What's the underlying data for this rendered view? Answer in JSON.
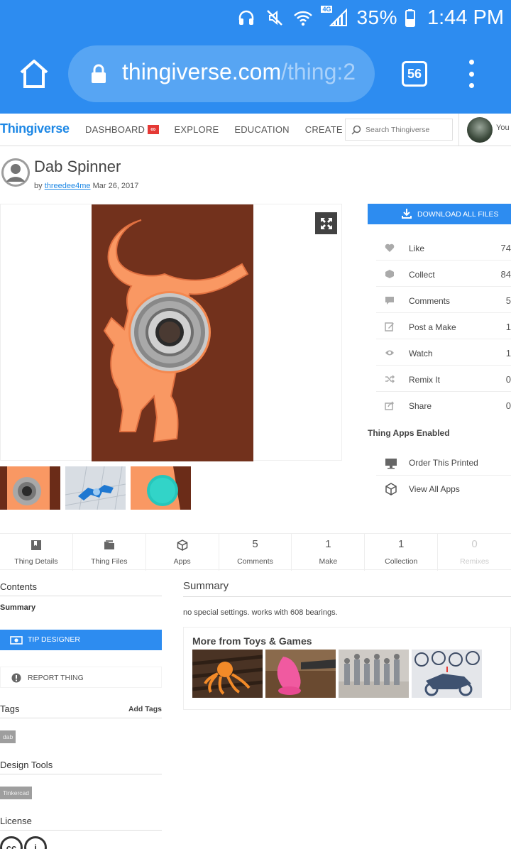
{
  "status_bar": {
    "battery": "35%",
    "time": "1:44 PM",
    "network": "4G"
  },
  "browser": {
    "url_host": "thingiverse.com",
    "url_path": "/thing:2",
    "tab_count": "56"
  },
  "site": {
    "logo": "Thingiverse",
    "nav": [
      "DASHBOARD",
      "EXPLORE",
      "EDUCATION",
      "CREATE"
    ],
    "dashboard_badge": "∞",
    "search_placeholder": "Search Thingiverse",
    "user_label": "You"
  },
  "thing": {
    "title": "Dab Spinner",
    "by": "by",
    "author": "threedee4me",
    "date": "Mar 26, 2017"
  },
  "sidebar": {
    "download_label": "DOWNLOAD ALL FILES",
    "actions": [
      {
        "label": "Like",
        "count": "74",
        "icon": "heart-icon"
      },
      {
        "label": "Collect",
        "count": "84",
        "icon": "collect-icon"
      },
      {
        "label": "Comments",
        "count": "5",
        "icon": "comment-icon"
      },
      {
        "label": "Post a Make",
        "count": "1",
        "icon": "edit-icon"
      },
      {
        "label": "Watch",
        "count": "1",
        "icon": "eye-icon"
      },
      {
        "label": "Remix It",
        "count": "0",
        "icon": "shuffle-icon"
      },
      {
        "label": "Share",
        "count": "0",
        "icon": "share-icon"
      }
    ],
    "apps_title": "Thing Apps Enabled",
    "apps": [
      {
        "label": "Order This Printed",
        "icon": "printer-icon"
      },
      {
        "label": "View All Apps",
        "icon": "cube-icon"
      }
    ]
  },
  "tabs": [
    {
      "label": "Thing Details",
      "num": ""
    },
    {
      "label": "Thing Files",
      "num": ""
    },
    {
      "label": "Apps",
      "num": ""
    },
    {
      "label": "Comments",
      "num": "5"
    },
    {
      "label": "Make",
      "num": "1"
    },
    {
      "label": "Collection",
      "num": "1"
    },
    {
      "label": "Remixes",
      "num": "0"
    }
  ],
  "left": {
    "contents": "Contents",
    "summary_link": "Summary",
    "tip": "TIP DESIGNER",
    "report": "REPORT THING",
    "tags": "Tags",
    "add_tags": "Add Tags",
    "tag_chip": "dab",
    "design_tools": "Design Tools",
    "tool_chip": "Tinkercad",
    "license": "License",
    "license_cc": "cc",
    "license_by": "i"
  },
  "summary": {
    "heading": "Summary",
    "text": "no special settings. works with 608 bearings.",
    "more_heading": "More from Toys & Games"
  },
  "colors": {
    "chrome_blue": "#2d8cf0",
    "brand_blue": "#1e88e5",
    "orange_print": "#f99863"
  }
}
